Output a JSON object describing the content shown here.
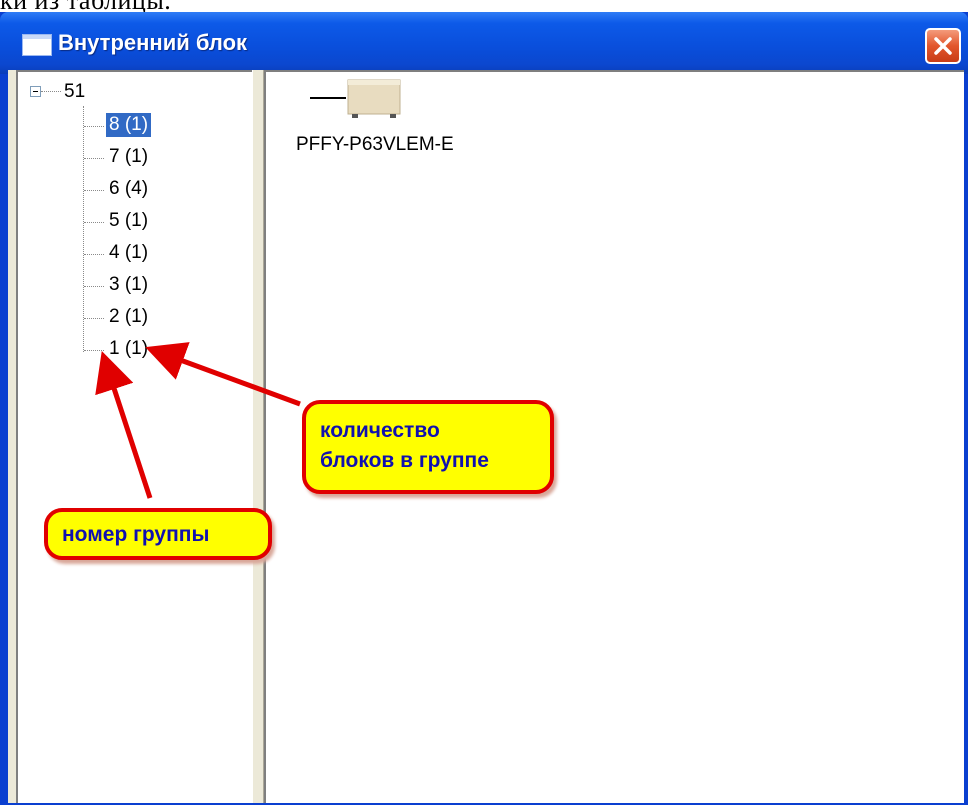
{
  "doc": {
    "cropped_text": "ки из таблицы."
  },
  "window": {
    "title": "Внутренний блок"
  },
  "tree": {
    "root_label": "51",
    "items": [
      {
        "label": "8 (1)",
        "selected": true
      },
      {
        "label": "7 (1)",
        "selected": false
      },
      {
        "label": "6 (4)",
        "selected": false
      },
      {
        "label": "5 (1)",
        "selected": false
      },
      {
        "label": "4 (1)",
        "selected": false
      },
      {
        "label": "3 (1)",
        "selected": false
      },
      {
        "label": "2 (1)",
        "selected": false
      },
      {
        "label": "1 (1)",
        "selected": false
      }
    ]
  },
  "device": {
    "model": "PFFY-P63VLEM-E",
    "icon": "indoor-unit-icon"
  },
  "callouts": {
    "count_line1": "количество",
    "count_line2": "блоков в группе",
    "group": "номер группы"
  },
  "colors": {
    "selection": "#316ac5",
    "callout_fill": "#ffff00",
    "callout_border": "#e00000",
    "callout_text": "#1010b0",
    "arrow": "#e00000"
  }
}
